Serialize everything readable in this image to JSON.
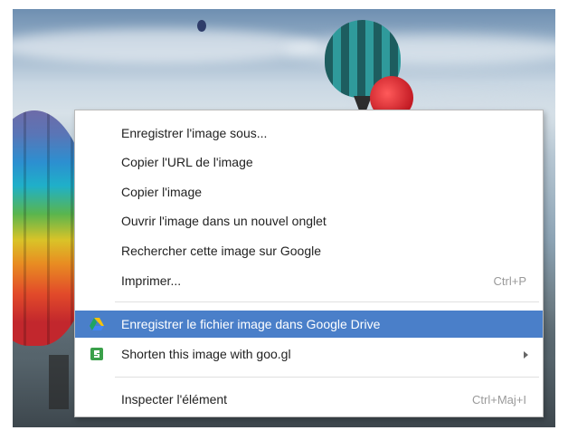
{
  "menu": {
    "items": [
      {
        "label": "Enregistrer l'image sous..."
      },
      {
        "label": "Copier l'URL de l'image"
      },
      {
        "label": "Copier l'image"
      },
      {
        "label": "Ouvrir l'image dans un nouvel onglet"
      },
      {
        "label": "Rechercher cette image sur Google"
      },
      {
        "label": "Imprimer...",
        "shortcut": "Ctrl+P"
      },
      {
        "label": "Enregistrer le fichier image dans Google Drive",
        "icon": "google-drive-icon"
      },
      {
        "label": "Shorten this image with goo.gl",
        "icon": "goo-gl-icon"
      },
      {
        "label": "Inspecter l'élément",
        "shortcut": "Ctrl+Maj+I"
      }
    ]
  },
  "colors": {
    "highlight": "#4a7fc9"
  }
}
